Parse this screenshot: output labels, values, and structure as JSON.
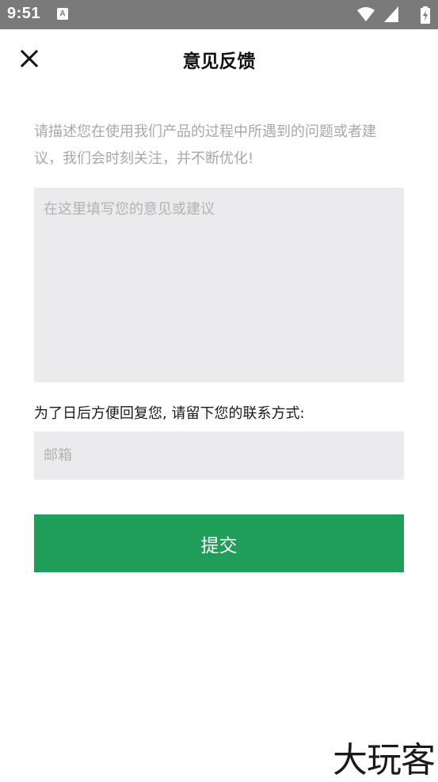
{
  "status_bar": {
    "time": "9:51",
    "notification_icon": "a-icon",
    "icons": [
      "wifi-icon",
      "signal-icon",
      "battery-charging-icon"
    ]
  },
  "header": {
    "close_icon": "close-icon",
    "title": "意见反馈"
  },
  "form": {
    "description": "请描述您在使用我们产品的过程中所遇到的问题或者建议，我们会时刻关注，并不断优化!",
    "feedback_placeholder": "在这里填写您的意见或建议",
    "feedback_value": "",
    "contact_label": "为了日后方便回复您, 请留下您的联系方式:",
    "email_placeholder": "邮箱",
    "email_value": "",
    "submit_label": "提交"
  },
  "watermark": "大玩客",
  "colors": {
    "status_bar": "#7a7a7a",
    "accent": "#1f9e5a",
    "input_background": "#ebebed",
    "hint_text": "#a8a8a8"
  }
}
